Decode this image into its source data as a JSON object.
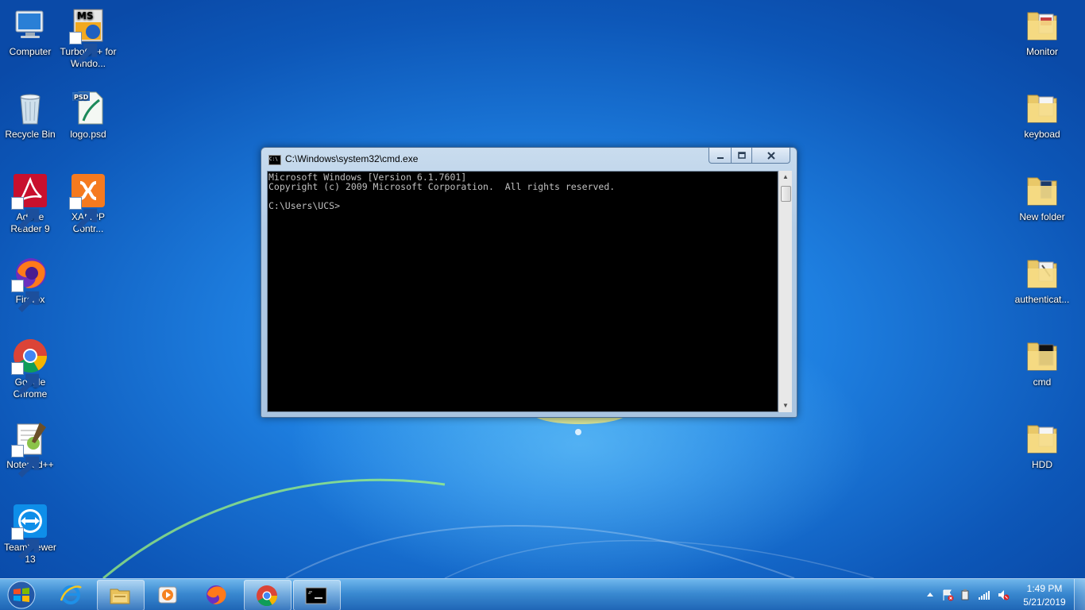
{
  "desktop_icons_left": [
    {
      "label": "Computer"
    },
    {
      "label": "TurboC++ for Windo..."
    },
    {
      "label": "Recycle Bin"
    },
    {
      "label": "logo.psd"
    },
    {
      "label": "Adobe Reader 9"
    },
    {
      "label": "XAMPP Contr..."
    },
    {
      "label": "Firefox"
    },
    {
      "label": "Google Chrome"
    },
    {
      "label": "Notepad++"
    },
    {
      "label": "TeamViewer 13"
    }
  ],
  "desktop_icons_right": [
    {
      "label": "Monitor"
    },
    {
      "label": "keyboad"
    },
    {
      "label": "New folder"
    },
    {
      "label": "authenticat..."
    },
    {
      "label": "cmd"
    },
    {
      "label": "HDD"
    }
  ],
  "icon_badges": {
    "turboc": "MS",
    "psd": "PSD"
  },
  "cmd_window": {
    "title": "C:\\Windows\\system32\\cmd.exe",
    "icon_text": "C:\\",
    "lines": [
      "Microsoft Windows [Version 6.1.7601]",
      "Copyright (c) 2009 Microsoft Corporation.  All rights reserved.",
      "",
      "C:\\Users\\UCS>"
    ],
    "text_color": "#c0c0c0",
    "background": "#000000"
  },
  "taskbar": {
    "pinned": [
      {
        "icon": "internet-explorer-icon"
      },
      {
        "icon": "windows-explorer-icon"
      },
      {
        "icon": "media-player-icon"
      },
      {
        "icon": "firefox-icon"
      },
      {
        "icon": "chrome-icon"
      },
      {
        "icon": "cmd-icon"
      }
    ],
    "clock_time": "1:49 PM",
    "clock_date": "5/21/2019"
  }
}
